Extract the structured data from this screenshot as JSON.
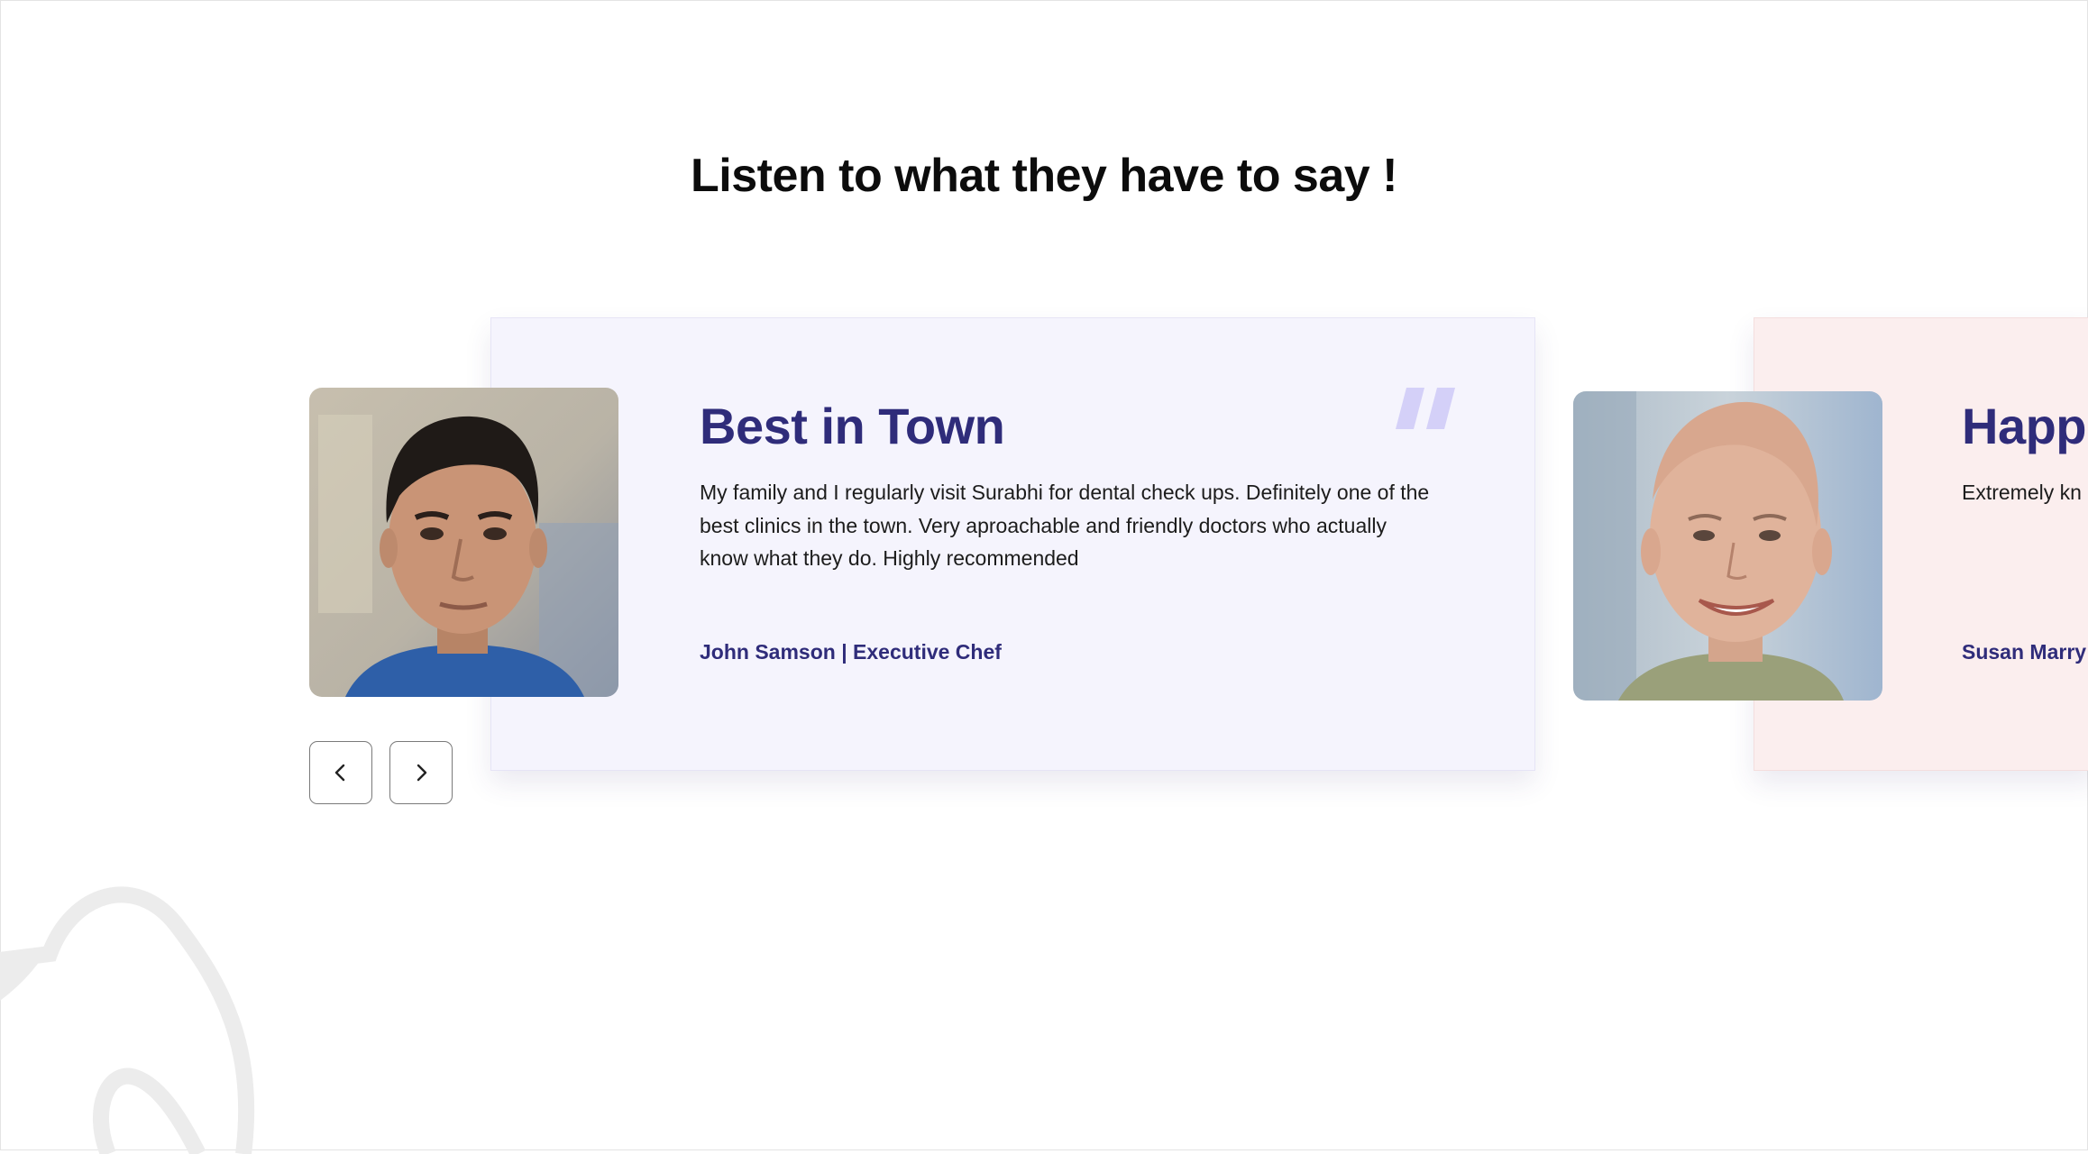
{
  "section": {
    "heading": "Listen to what they have to say !"
  },
  "testimonials": [
    {
      "title": "Best in Town",
      "text": "My family and I regularly visit Surabhi for dental check ups. Definitely one of the best clinics in the town. Very aproachable and friendly doctors who actually know what they do. Highly recommended",
      "author": "John Samson | Executive Chef",
      "card_color": "#f5f4fd"
    },
    {
      "title": "Happ",
      "text": "Extremely kn and well exp Regular visito",
      "author": "Susan Marry",
      "card_color": "#fbeeee"
    }
  ],
  "icons": {
    "quote": "quote-icon",
    "prev": "chevron-left-icon",
    "next": "chevron-right-icon",
    "decoration": "tooth-outline-icon"
  },
  "colors": {
    "accent": "#2f2c7a",
    "quote_mark": "#d4d0f8",
    "heading": "#0c0c0c"
  }
}
